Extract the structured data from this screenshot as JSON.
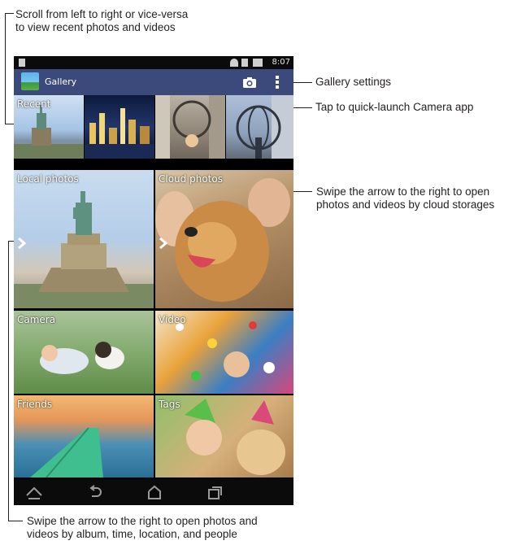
{
  "annotations": {
    "scroll_recent": "Scroll from left to right or vice-versa\nto view recent photos and videos",
    "gallery_settings": "Gallery settings",
    "quick_launch_camera": "Tap to quick-launch Camera app",
    "swipe_cloud": "Swipe the arrow to the right to open\nphotos and videos by cloud storages",
    "swipe_album": "Swipe the arrow to the right to open photos and\nvideos by album, time, location, and people"
  },
  "status_bar": {
    "time": "8:07"
  },
  "action_bar": {
    "title": "Gallery"
  },
  "tiles": {
    "recent": "Recent",
    "local_photos": "Local photos",
    "cloud_photos": "Cloud photos",
    "camera": "Camera",
    "video": "Video",
    "friends": "Friends",
    "tags": "Tags"
  },
  "icons": {
    "camera": "camera-icon",
    "settings": "overflow-menu-icon",
    "home": "home-icon",
    "back": "back-icon",
    "recents": "recent-apps-icon"
  },
  "colors": {
    "action_bar": "#3b4a7a",
    "navigation_bar": "#0b0b0b"
  }
}
